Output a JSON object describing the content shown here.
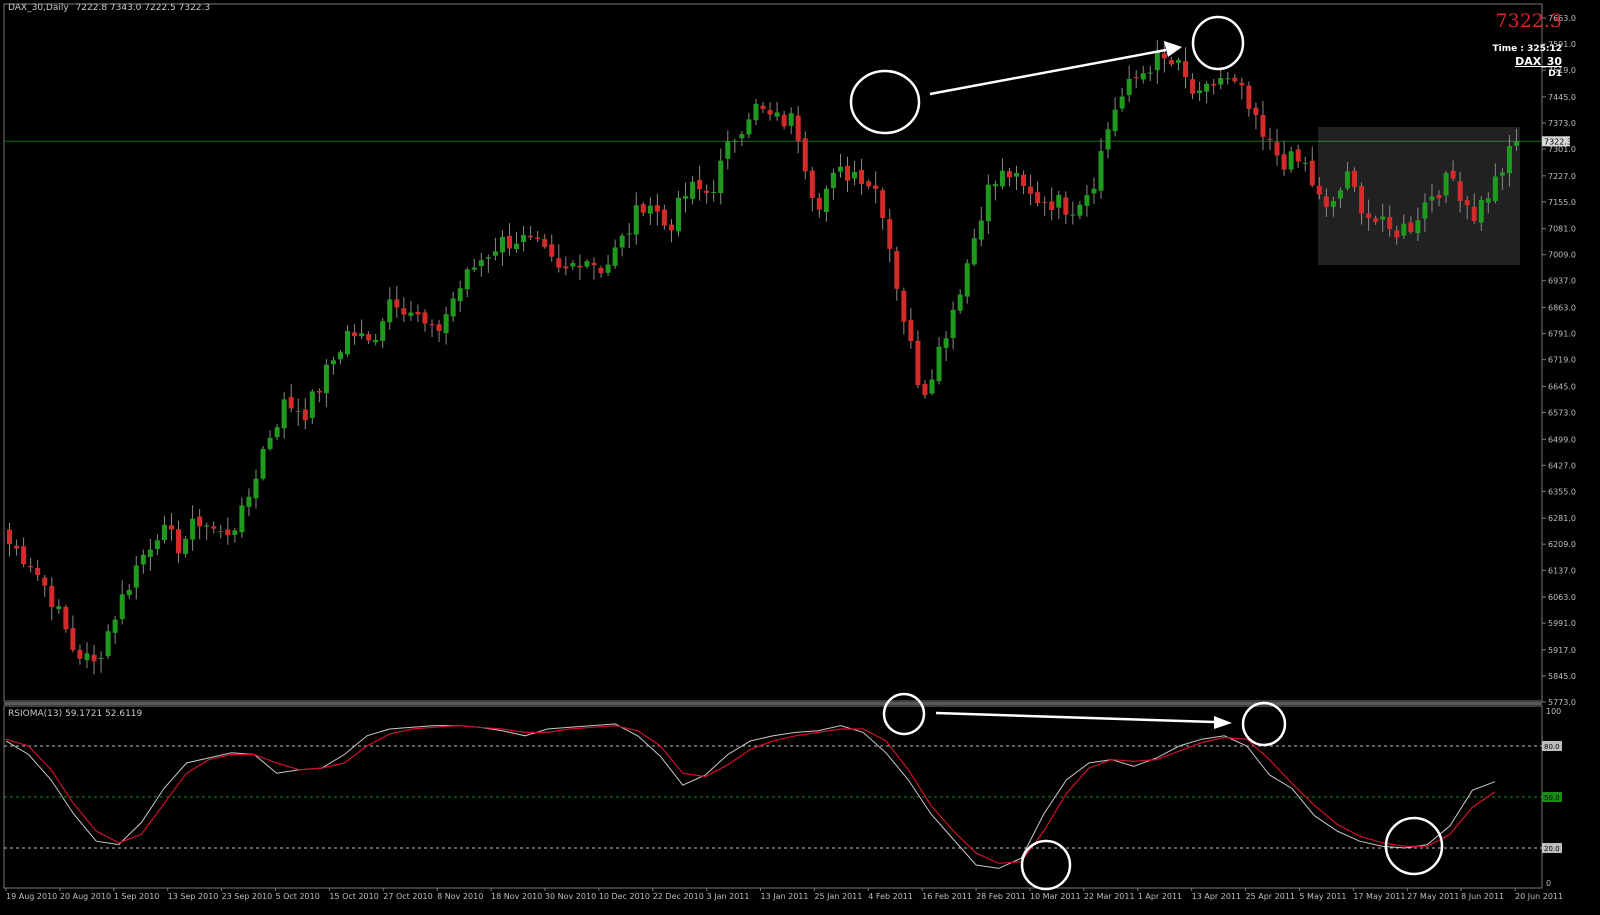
{
  "header": {
    "symbol": "DAX_30,Daily",
    "ohlc": "7222.8 7343.0 7222.5 7322.3"
  },
  "info_panel": {
    "last_price": "7322.3",
    "time_label": "Time : 325:12",
    "symbol": "DAX_30",
    "timeframe": "D1"
  },
  "indicator": {
    "label": "RSIOMA(13) 59.1721 52.6119",
    "level_80": "80.0",
    "level_50": "50.0",
    "level_20": "20.0",
    "axis_top": "100",
    "axis_bottom": "0"
  },
  "colors": {
    "bull": "#1f9a1f",
    "bear": "#d52a2a",
    "rsi_line": "#c8c8c8",
    "signal_line": "#d0102a",
    "level_50": "#1a8c1a",
    "grid_text": "#bdbdbd"
  },
  "chart_data": [
    {
      "type": "candlestick",
      "ylim": [
        5773.0,
        7663.0
      ],
      "y_ticks": [
        "7663.0",
        "7591.0",
        "7519.0",
        "7445.0",
        "7373.0",
        "7301.0",
        "7227.0",
        "7155.0",
        "7081.0",
        "7009.0",
        "6937.0",
        "6863.0",
        "6791.0",
        "6719.0",
        "6645.0",
        "6573.0",
        "6499.0",
        "6427.0",
        "6355.0",
        "6281.0",
        "6209.0",
        "6137.0",
        "6063.0",
        "5991.0",
        "5917.0",
        "5845.0",
        "5773.0"
      ],
      "current_price_label": "7322.3",
      "x_ticks": [
        "19 Aug 2010",
        "20 Aug 2010",
        "1 Sep 2010",
        "13 Sep 2010",
        "23 Sep 2010",
        "5 Oct 2010",
        "15 Oct 2010",
        "27 Oct 2010",
        "8 Nov 2010",
        "18 Nov 2010",
        "30 Nov 2010",
        "10 Dec 2010",
        "22 Dec 2010",
        "3 Jan 2011",
        "13 Jan 2011",
        "25 Jan 2011",
        "4 Feb 2011",
        "16 Feb 2011",
        "28 Feb 2011",
        "10 Mar 2011",
        "22 Mar 2011",
        "1 Apr 2011",
        "13 Apr 2011",
        "25 Apr 2011",
        "5 May 2011",
        "17 May 2011",
        "27 May 2011",
        "8 Jun 2011",
        "20 Jun 2011"
      ],
      "close_path": [
        6210,
        6160,
        6060,
        5920,
        5875,
        6020,
        6150,
        6250,
        6205,
        6280,
        6230,
        6290,
        6480,
        6600,
        6575,
        6690,
        6800,
        6760,
        6900,
        6850,
        6780,
        6900,
        6985,
        7040,
        7055,
        7020,
        6950,
        7010,
        6970,
        7060,
        7170,
        7080,
        7190,
        7180,
        7320,
        7420,
        7380,
        7380,
        7150,
        7230,
        7240,
        7180,
        6870,
        6620,
        6780,
        6960,
        7180,
        7240,
        7170,
        7160,
        7140,
        7200,
        7410,
        7490,
        7550,
        7530,
        7430,
        7500,
        7460,
        7330,
        7270,
        7260,
        7120,
        7220,
        7120,
        7070,
        7090,
        7180,
        7220,
        7120,
        7210,
        7322
      ],
      "annotations": [
        "circle around local high (Feb 2011)",
        "circle around higher high (Apr 2011)",
        "arrow between highs",
        "shaded consolidation box (late May–Jun 2011)"
      ]
    },
    {
      "type": "line",
      "title": "RSIOMA(13) 59.1721 52.6119",
      "ylim": [
        0,
        100
      ],
      "levels": [
        80,
        50,
        20
      ],
      "series": [
        {
          "values": [
            83,
            75,
            60,
            40,
            24,
            22,
            35,
            55,
            70,
            73,
            76,
            75,
            64,
            66,
            67,
            75,
            86,
            90,
            91,
            92,
            92,
            91,
            89,
            86,
            90,
            91,
            92,
            93,
            86,
            74,
            57,
            63,
            75,
            83,
            86,
            88,
            89,
            92,
            88,
            76,
            60,
            40,
            25,
            10,
            8,
            14,
            40,
            60,
            70,
            72,
            68,
            73,
            80,
            84,
            86,
            80,
            63,
            55,
            39,
            30,
            24,
            21,
            20,
            22,
            33,
            54,
            59
          ]
        },
        {
          "values": [
            84,
            80,
            66,
            46,
            30,
            23,
            28,
            46,
            64,
            72,
            75,
            75,
            70,
            66,
            67,
            70,
            80,
            87,
            90,
            91,
            92,
            91,
            90,
            88,
            88,
            90,
            91,
            92,
            89,
            80,
            64,
            62,
            69,
            78,
            83,
            86,
            88,
            90,
            90,
            83,
            66,
            45,
            30,
            17,
            11,
            12,
            30,
            52,
            67,
            72,
            71,
            72,
            77,
            82,
            85,
            84,
            72,
            58,
            45,
            34,
            27,
            23,
            21,
            21,
            28,
            44,
            53
          ]
        }
      ],
      "annotations": [
        "circle at RSI high (Feb 2011)",
        "circle at lower RSI high (Apr 2011)",
        "arrow between RSI highs (bearish divergence)",
        "circle at RSI low (Mar 2011)",
        "circle at RSI low (Jun 2011)"
      ]
    }
  ]
}
